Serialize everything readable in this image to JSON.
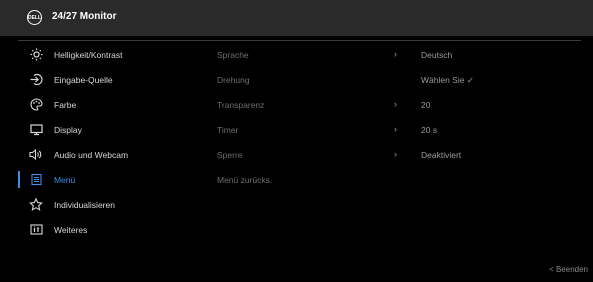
{
  "header": {
    "logo_text": "DELL",
    "title": "24/27 Monitor"
  },
  "menu": [
    {
      "label": "Helligkeit/Kontrast",
      "icon": "brightness-icon"
    },
    {
      "label": "Eingabe-Quelle",
      "icon": "input-source-icon"
    },
    {
      "label": "Farbe",
      "icon": "color-palette-icon"
    },
    {
      "label": "Display",
      "icon": "display-icon"
    },
    {
      "label": "Audio und Webcam",
      "icon": "speaker-icon"
    },
    {
      "label": "Menü",
      "icon": "menu-icon",
      "active": true
    },
    {
      "label": "Individualisieren",
      "icon": "star-icon"
    },
    {
      "label": "Weiteres",
      "icon": "info-icon"
    }
  ],
  "submenu": [
    {
      "label": "Sprache",
      "value": "Deutsch",
      "has_arrow": true
    },
    {
      "label": "Drehung",
      "value": "Wählen Sie ✓",
      "has_arrow": false
    },
    {
      "label": "Transparenz",
      "value": "20",
      "has_arrow": true
    },
    {
      "label": "Timer",
      "value": "20 s",
      "has_arrow": true
    },
    {
      "label": "Sperre",
      "value": "Deaktiviert",
      "has_arrow": true
    },
    {
      "label": "Menü zurücks.",
      "value": "",
      "has_arrow": false
    }
  ],
  "footer": {
    "exit_label": "< Beenden"
  },
  "colors": {
    "accent": "#3f8de6",
    "titlebar": "#2a2a2a",
    "background": "#000000"
  }
}
